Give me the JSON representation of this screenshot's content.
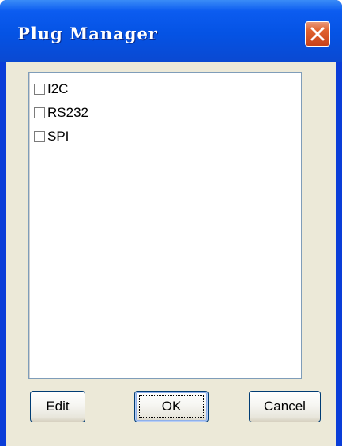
{
  "window": {
    "title": "Plug Manager"
  },
  "titlebar": {
    "close_icon": "close-icon"
  },
  "plugins": [
    {
      "label": "I2C",
      "checked": false
    },
    {
      "label": "RS232",
      "checked": false
    },
    {
      "label": "SPI",
      "checked": false
    }
  ],
  "buttons": {
    "edit_label": "Edit",
    "ok_label": "OK",
    "cancel_label": "Cancel"
  },
  "colors": {
    "titlebar": "#0553e4",
    "close_button": "#e0622f",
    "dialog_background": "#ece9d8"
  }
}
